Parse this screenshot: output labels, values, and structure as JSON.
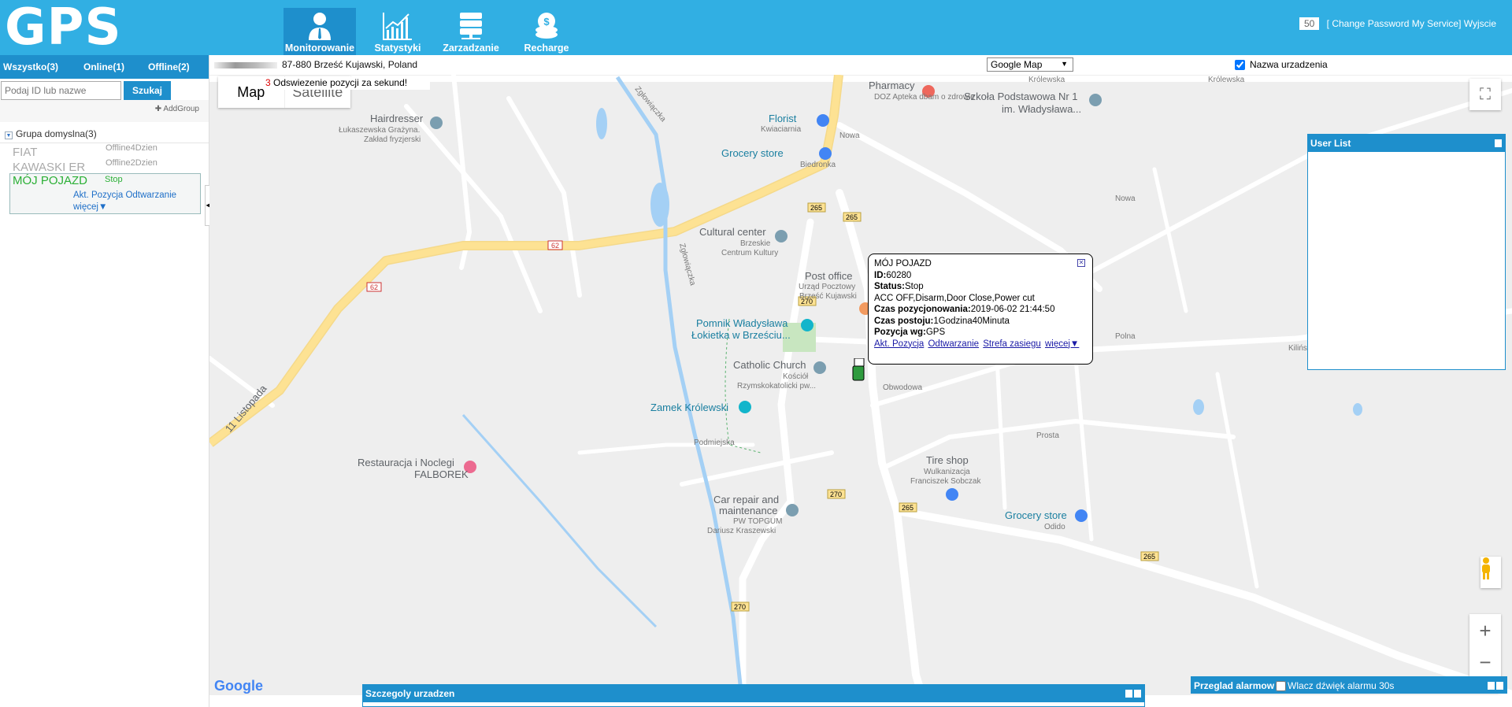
{
  "header": {
    "logo": "GPS",
    "nav": [
      {
        "label": "Monitorowanie",
        "icon": "user-icon",
        "active": true
      },
      {
        "label": "Statystyki",
        "icon": "chart-icon"
      },
      {
        "label": "Zarzadzanie",
        "icon": "server-icon"
      },
      {
        "label": "Recharge",
        "icon": "coins-icon"
      }
    ],
    "count": "50",
    "change_password": "[ Change Password",
    "my_service": "My Service]",
    "logout": "Wyjscie",
    "bg_color": "#31afe3"
  },
  "sidebar": {
    "tabs": [
      {
        "label": "Wszystko(3)"
      },
      {
        "label": "Online(1)"
      },
      {
        "label": "Offline(2)"
      }
    ],
    "search_placeholder": "Podaj ID lub nazwe",
    "search_button": "Szukaj",
    "add_group": "AddGroup",
    "group": "Grupa domyslna(3)",
    "devices": [
      {
        "name": "FIAT",
        "status": "Offline4Dzien"
      },
      {
        "name": "KAWASKI ER",
        "status": "Offline2Dzien"
      }
    ],
    "selected": {
      "name": "MÓJ POJAZD",
      "status": "Stop",
      "actions": "Akt. Pozycja Odtwarzanie",
      "more": "więcej▼"
    }
  },
  "toolbar": {
    "address": "87-880 Brześć Kujawski, Poland",
    "map_provider": "Google Map",
    "show_name_label": "Nazwa urzadzenia",
    "show_name_checked": true
  },
  "map": {
    "type_map": "Map",
    "type_satellite": "Satellite",
    "refresh_count": "3",
    "refresh_text": "Odswiezenie pozycji za sekund!",
    "google": "Google",
    "labels": {
      "pharmacy": "Pharmacy",
      "pharmacy_sub": "DOZ Apteka dbam o zdrowie",
      "school": "Szkoła Podstawowa Nr 1",
      "school_sub": "im. Władysława...",
      "hairdresser": "Hairdresser",
      "hairdresser_sub1": "Łukaszewska Grażyna.",
      "hairdresser_sub2": "Zakład fryzjerski",
      "florist": "Florist",
      "florist_sub": "Kwiaciarnia",
      "grocery1": "Grocery store",
      "grocery1_sub": "Biedronka",
      "cultural": "Cultural center",
      "cultural_sub1": "Brzeskie",
      "cultural_sub2": "Centrum Kultury",
      "post": "Post office",
      "post_sub1": "Urząd Pocztowy",
      "post_sub2": "Brześć Kujawski",
      "pomnik1": "Pomnik Władysława",
      "pomnik2": "Łokietka w Brześciu...",
      "church": "Catholic Church",
      "church_sub1": "Kościół",
      "church_sub2": "Rzymskokatolicki pw...",
      "zamek": "Zamek Królewski",
      "restaurant1": "Restauracja i Noclegi",
      "restaurant2": "FALBOREK",
      "tire": "Tire shop",
      "tire_sub1": "Wulkanizacja",
      "tire_sub2": "Franciszek Sobczak",
      "car1": "Car repair and",
      "car2": "maintenance",
      "car_sub1": "PW TOPGUM",
      "car_sub2": "Dariusz Kraszewski",
      "grocery2": "Grocery store",
      "grocery2_sub": "Odido",
      "krolewska": "Królewska",
      "nowa": "Nowa",
      "polna": "Polna",
      "prosta": "Prosta",
      "obwodowa": "Obwodowa",
      "podmiejska": "Podmiejska",
      "listopada": "11 Listopada",
      "zglowiaczka": "Zgłowiączka",
      "kilinskiego": "Kilińskiego",
      "r62": "62",
      "r265": "265",
      "r270": "270"
    }
  },
  "popup": {
    "title": "MÓJ POJAZD",
    "id_label": "ID:",
    "id": "60280",
    "status_label": "Status:",
    "status": "Stop",
    "flags": "ACC OFF,Disarm,Door Close,Power cut",
    "time_label": "Czas pozycjonowania:",
    "time": "2019-06-02 21:44:50",
    "stop_label": "Czas postoju:",
    "stop": "1Godzina40Minuta",
    "source_label": "Pozycja wg:",
    "source": "GPS",
    "links": [
      "Akt. Pozycja",
      "Odtwarzanie",
      "Strefa zasiegu",
      "więcej▼"
    ]
  },
  "panels": {
    "user_list": "User List",
    "details": "Szczegoly urzadzen",
    "alarms": "Przeglad alarmow",
    "alarm_sound": "Wlacz dźwięk alarmu 30s"
  }
}
